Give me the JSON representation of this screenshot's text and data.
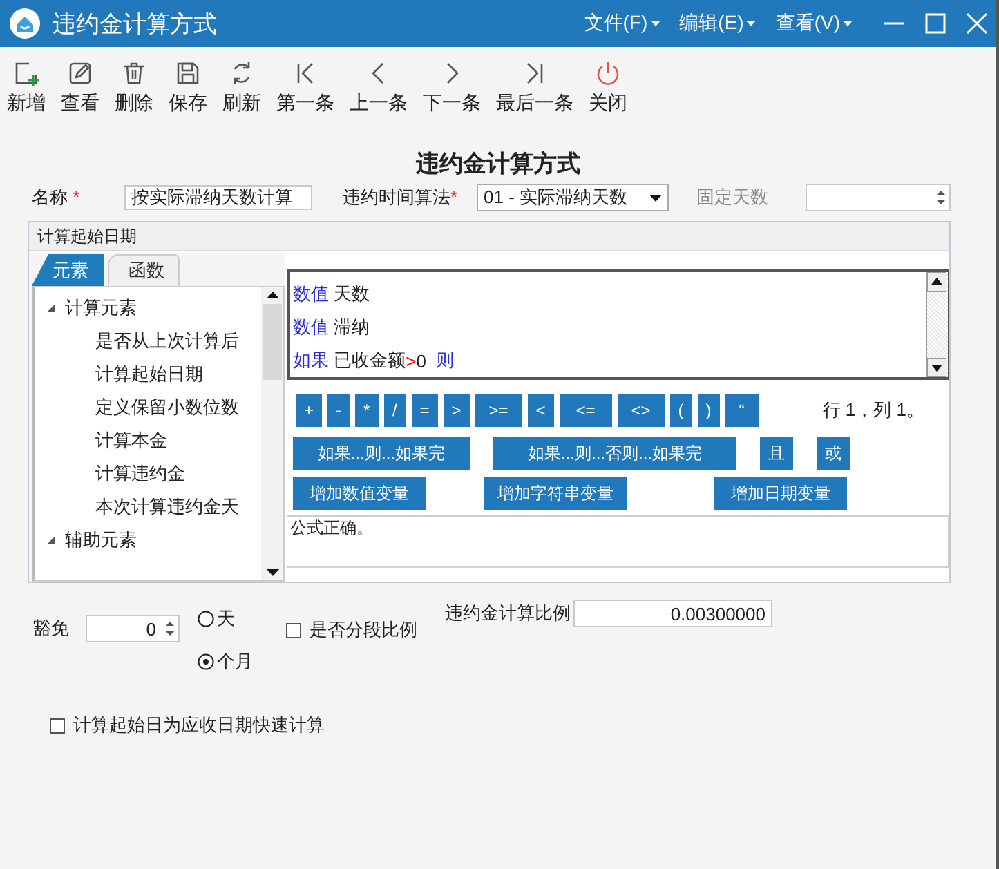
{
  "window": {
    "title": "违约金计算方式",
    "menus": [
      "文件(F)",
      "编辑(E)",
      "查看(V)"
    ]
  },
  "toolbar": [
    {
      "kind": "add",
      "label": "新增"
    },
    {
      "kind": "view",
      "label": "查看"
    },
    {
      "kind": "delete",
      "label": "删除"
    },
    {
      "kind": "save",
      "label": "保存"
    },
    {
      "kind": "refresh",
      "label": "刷新"
    },
    {
      "kind": "first",
      "label": "第一条"
    },
    {
      "kind": "prev",
      "label": "上一条"
    },
    {
      "kind": "next",
      "label": "下一条"
    },
    {
      "kind": "last",
      "label": "最后一条"
    },
    {
      "kind": "close",
      "label": "关闭"
    }
  ],
  "heading": "违约金计算方式",
  "form": {
    "name": {
      "label": "名称",
      "required_mark": "*",
      "value": "按实际滞纳天数计算"
    },
    "method": {
      "label": "违约时间算法",
      "required_mark": "*",
      "value": "01 - 实际滞纳天数"
    },
    "fixed_days": {
      "label": "固定天数",
      "disabled": true
    }
  },
  "group": {
    "title": "计算起始日期",
    "tabs": [
      {
        "label": "元素",
        "selected": true
      },
      {
        "label": "函数",
        "selected": false
      }
    ],
    "tree": [
      {
        "label": "计算元素",
        "expanded": true,
        "children": [
          {
            "label": "是否从上次计算后"
          },
          {
            "label": "计算起始日期"
          },
          {
            "label": "定义保留小数位数"
          },
          {
            "label": "计算本金"
          },
          {
            "label": "计算违约金"
          },
          {
            "label": "本次计算违约金天"
          }
        ]
      },
      {
        "label": "辅助元素",
        "expanded": true
      }
    ],
    "formula": {
      "lines": [
        {
          "segments": [
            {
              "kind": "keyword",
              "text": "数值"
            },
            {
              "kind": "plain",
              "text": " 天数"
            }
          ]
        },
        {
          "segments": [
            {
              "kind": "keyword",
              "text": "数值"
            },
            {
              "kind": "plain",
              "text": " 滞纳"
            }
          ]
        },
        {
          "segments": [
            {
              "kind": "keyword",
              "text": "如果"
            },
            {
              "kind": "plain",
              "text": " 已收金额"
            },
            {
              "kind": "operator",
              "text": ">"
            },
            {
              "kind": "plain",
              "text": "0"
            },
            {
              "kind": "keyword",
              "text": "  则"
            }
          ]
        }
      ]
    },
    "operators": [
      "+",
      "-",
      "*",
      "/",
      "=",
      ">",
      ">=",
      "<",
      "<=",
      "<>",
      "(",
      ")",
      "“"
    ],
    "cursor": "行 1，列 1。",
    "logic_buttons": [
      "如果...则...如果完",
      "如果...则...否则...如果完",
      "且",
      "或"
    ],
    "variable_buttons": [
      "增加数值变量",
      "增加字符串变量",
      "增加日期变量"
    ],
    "message": "公式正确。"
  },
  "exemption": {
    "label": "豁免",
    "value": "0"
  },
  "units": [
    {
      "label": "天",
      "selected": false
    },
    {
      "label": "个月",
      "selected": true
    }
  ],
  "segmented": {
    "label": "是否分段比例",
    "checked": false
  },
  "ratio": {
    "label": "违约金计算比例",
    "value": "0.00300000"
  },
  "quick_calc": {
    "label": "计算起始日为应收日期快速计算",
    "checked": false
  }
}
